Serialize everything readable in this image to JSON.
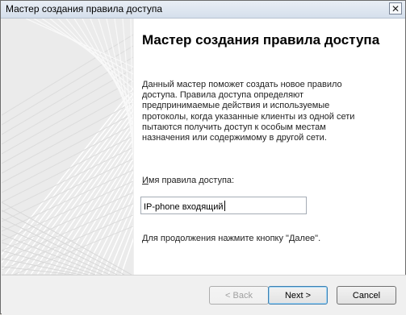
{
  "window": {
    "title": "Мастер создания правила доступа",
    "close_glyph": "✕"
  },
  "panel": {
    "heading": "Мастер создания правила доступа",
    "description": "Данный мастер поможет создать новое правило\nдоступа. Правила доступа определяют\nпредпринимаемые действия и используемые\nпротоколы, когда указанные клиенты из одной сети\nпытаются получить доступ к особым местам\nназначения или содержимому в другой сети.",
    "name_label": "Имя правила доступа:",
    "name_value": "IP-phone входящий",
    "hint": "Для продолжения нажмите кнопку \"Далее\"."
  },
  "buttons": {
    "back": "< Back",
    "next": "Next >",
    "cancel": "Cancel"
  },
  "icons": {
    "close": "close-icon"
  },
  "colors": {
    "title_bar": "#dae3ef",
    "art_bg": "#ebebeb",
    "default_button_border": "#3c7fb1"
  }
}
